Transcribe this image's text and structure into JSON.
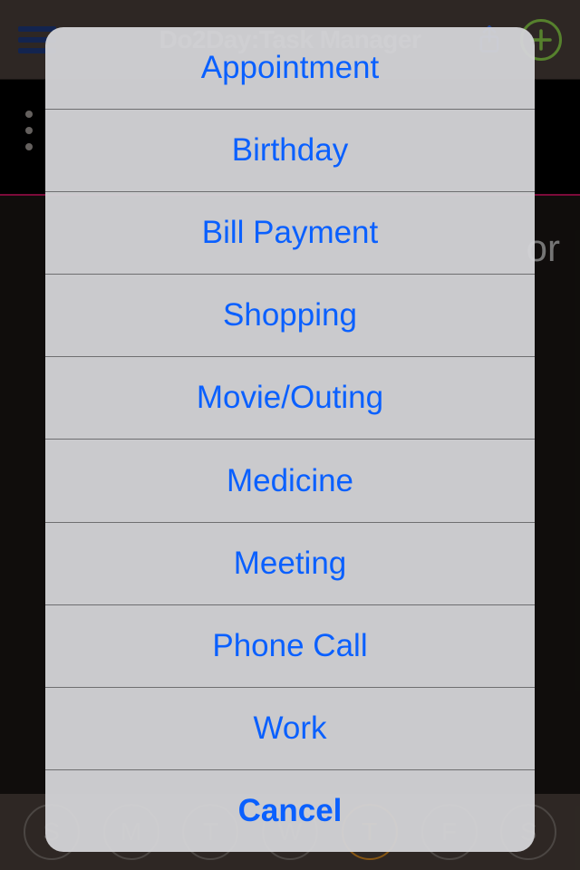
{
  "header": {
    "title": "Do2Day:Task Manager"
  },
  "background": {
    "hint_fragment": "or"
  },
  "week": {
    "days": [
      "S",
      "M",
      "T",
      "W",
      "T",
      "F",
      "S"
    ],
    "activeIndex": 4
  },
  "sheet": {
    "items": [
      "Appointment",
      "Birthday",
      "Bill Payment",
      "Shopping",
      "Movie/Outing",
      "Medicine",
      "Meeting",
      "Phone Call",
      "Work"
    ],
    "cancel": "Cancel"
  }
}
